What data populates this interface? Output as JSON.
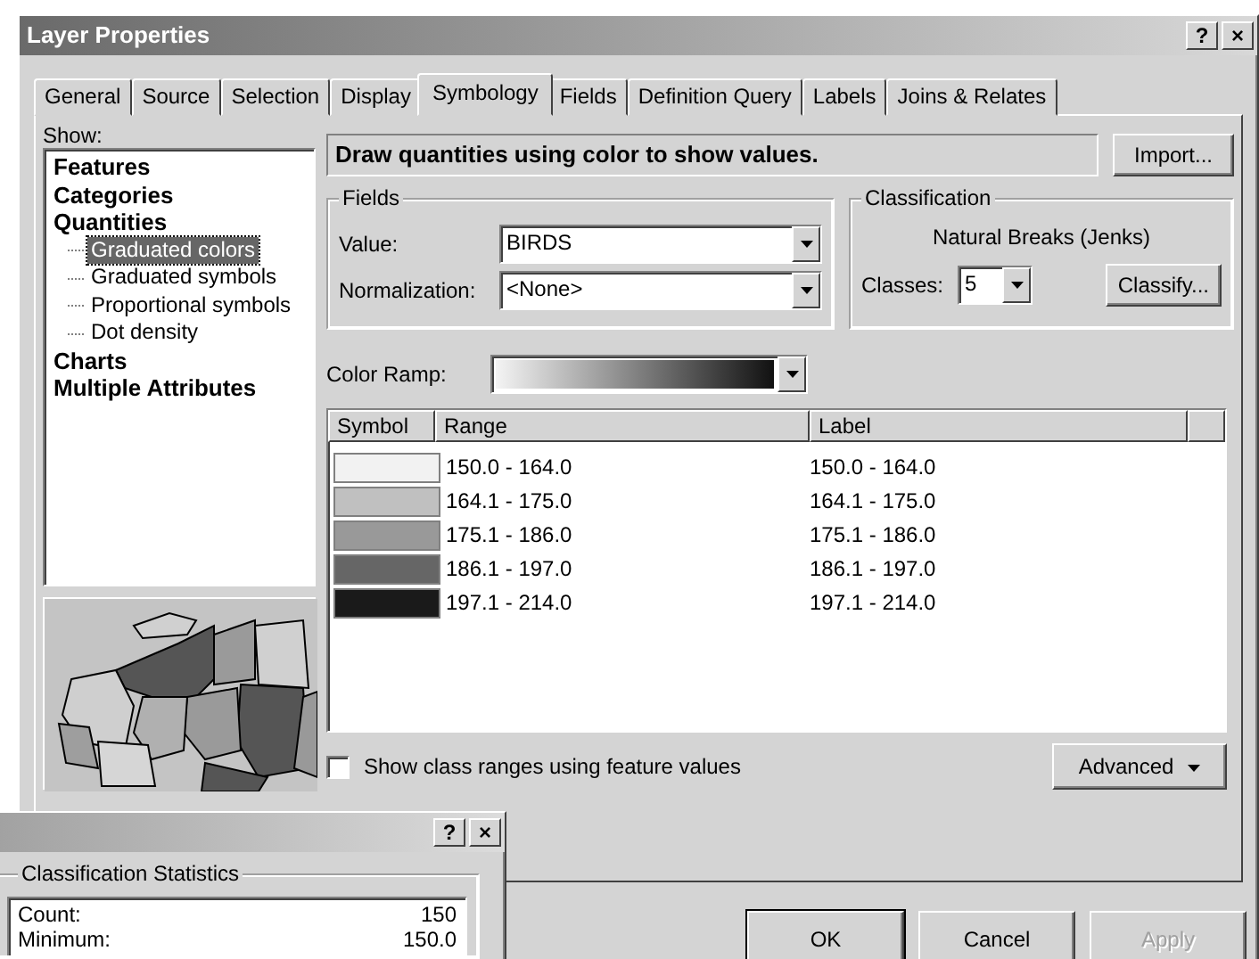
{
  "main_window": {
    "title": "Layer Properties",
    "title_buttons": [
      "?",
      "×"
    ],
    "tabs": [
      {
        "label": "General",
        "selected": false
      },
      {
        "label": "Source",
        "selected": false
      },
      {
        "label": "Selection",
        "selected": false
      },
      {
        "label": "Display",
        "selected": false
      },
      {
        "label": "Symbology",
        "selected": true
      },
      {
        "label": "Fields",
        "selected": false
      },
      {
        "label": "Definition Query",
        "selected": false
      },
      {
        "label": "Labels",
        "selected": false
      },
      {
        "label": "Joins & Relates",
        "selected": false
      }
    ],
    "show_label": "Show:",
    "tree": [
      {
        "label": "Features",
        "selected": false
      },
      {
        "label": "Categories",
        "selected": false
      },
      {
        "label": "Quantities",
        "selected": false,
        "children": [
          {
            "label": "Graduated colors",
            "selected": true
          },
          {
            "label": "Graduated symbols",
            "selected": false
          },
          {
            "label": "Proportional symbols",
            "selected": false
          },
          {
            "label": "Dot density",
            "selected": false
          }
        ]
      },
      {
        "label": "Charts",
        "selected": false
      },
      {
        "label": "Multiple Attributes",
        "selected": false
      }
    ],
    "description": "Draw quantities using color to show values.",
    "import_button": "Import...",
    "fields": {
      "title": "Fields",
      "value_label": "Value:",
      "value": "BIRDS",
      "normalization_label": "Normalization:",
      "normalization": "<None>"
    },
    "classification": {
      "title": "Classification",
      "method": "Natural Breaks (Jenks)",
      "classes_label": "Classes:",
      "classes": "5",
      "classify_button": "Classify..."
    },
    "color_ramp_label": "Color Ramp:",
    "table": {
      "columns": [
        "Symbol",
        "Range",
        "Label"
      ],
      "rows": [
        {
          "color": "#f2f2f2",
          "range": "150.0 - 164.0",
          "label": "150.0 - 164.0"
        },
        {
          "color": "#c0c0c0",
          "range": "164.1 - 175.0",
          "label": "164.1 - 175.0"
        },
        {
          "color": "#999999",
          "range": "175.1 - 186.0",
          "label": "175.1 - 186.0"
        },
        {
          "color": "#666666",
          "range": "186.1 - 197.0",
          "label": "186.1 - 197.0"
        },
        {
          "color": "#1a1a1a",
          "range": "197.1 - 214.0",
          "label": "197.1 - 214.0"
        }
      ]
    },
    "show_class_ranges": {
      "label": "Show class ranges using feature values",
      "checked": false
    },
    "advanced_button": "Advanced",
    "buttons": [
      {
        "label": "OK",
        "disabled": false
      },
      {
        "label": "Cancel",
        "disabled": false
      },
      {
        "label": "Apply",
        "disabled": true
      }
    ]
  },
  "stats_window": {
    "title_buttons": [
      "?",
      "×"
    ],
    "group_title": "Classification Statistics",
    "stats": [
      {
        "label": "Count:",
        "value": "150"
      },
      {
        "label": "Minimum:",
        "value": "150.0"
      }
    ]
  }
}
